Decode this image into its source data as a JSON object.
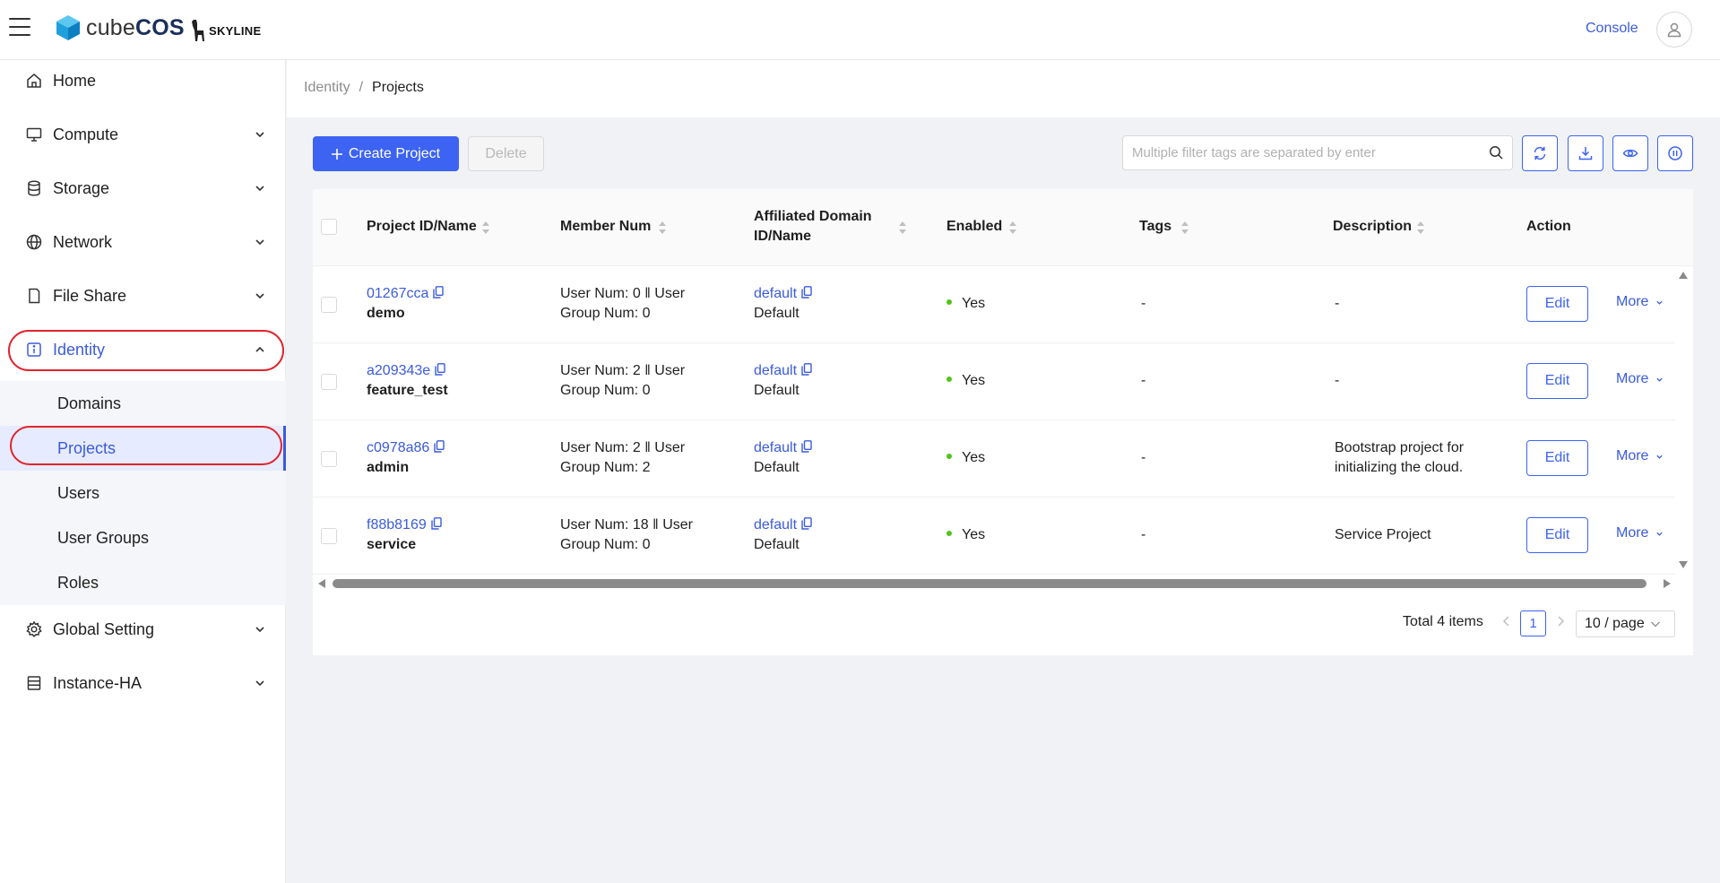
{
  "header": {
    "logo_prefix": "cube",
    "logo_suffix": "COS",
    "partner_logo": "SKYLINE",
    "console_label": "Console"
  },
  "sidebar": {
    "items": [
      {
        "label": "Home",
        "icon": "home-icon"
      },
      {
        "label": "Compute",
        "icon": "monitor-icon"
      },
      {
        "label": "Storage",
        "icon": "database-icon"
      },
      {
        "label": "Network",
        "icon": "globe-icon"
      },
      {
        "label": "File Share",
        "icon": "file-icon"
      },
      {
        "label": "Identity",
        "icon": "info-icon"
      },
      {
        "label": "Global Setting",
        "icon": "gear-icon"
      },
      {
        "label": "Instance-HA",
        "icon": "server-icon"
      }
    ],
    "identity_submenu": [
      "Domains",
      "Projects",
      "Users",
      "User Groups",
      "Roles"
    ]
  },
  "breadcrumb": {
    "parent": "Identity",
    "separator": "/",
    "current": "Projects"
  },
  "toolbar": {
    "create_label": "Create Project",
    "delete_label": "Delete",
    "search_placeholder": "Multiple filter tags are separated by enter"
  },
  "table": {
    "headers": {
      "id_name": "Project ID/Name",
      "member_num": "Member Num",
      "domain_line1": "Affiliated Domain",
      "domain_line2": "ID/Name",
      "enabled": "Enabled",
      "tags": "Tags",
      "description": "Description",
      "action": "Action"
    },
    "rows": [
      {
        "id": "01267cca",
        "name": "demo",
        "member1": "User Num: 0 ‖ User",
        "member2": "Group Num: 0",
        "domain_id": "default",
        "domain_name": "Default",
        "enabled": "Yes",
        "tags": "-",
        "desc1": "-",
        "desc2": "",
        "edit": "Edit",
        "more": "More"
      },
      {
        "id": "a209343e",
        "name": "feature_test",
        "member1": "User Num: 2 ‖ User",
        "member2": "Group Num: 0",
        "domain_id": "default",
        "domain_name": "Default",
        "enabled": "Yes",
        "tags": "-",
        "desc1": "-",
        "desc2": "",
        "edit": "Edit",
        "more": "More"
      },
      {
        "id": "c0978a86",
        "name": "admin",
        "member1": "User Num: 2 ‖ User",
        "member2": "Group Num: 2",
        "domain_id": "default",
        "domain_name": "Default",
        "enabled": "Yes",
        "tags": "-",
        "desc1": "Bootstrap project for",
        "desc2": "initializing the cloud.",
        "edit": "Edit",
        "more": "More"
      },
      {
        "id": "f88b8169",
        "name": "service",
        "member1": "User Num: 18 ‖ User",
        "member2": "Group Num: 0",
        "domain_id": "default",
        "domain_name": "Default",
        "enabled": "Yes",
        "tags": "-",
        "desc1": "Service Project",
        "desc2": "",
        "edit": "Edit",
        "more": "More"
      }
    ]
  },
  "pagination": {
    "total": "Total 4 items",
    "current_page": "1",
    "page_size": "10 / page"
  },
  "colors": {
    "primary": "#3d63f2",
    "link": "#3b5bdb",
    "success": "#52c41a",
    "highlight": "#e0242e"
  }
}
